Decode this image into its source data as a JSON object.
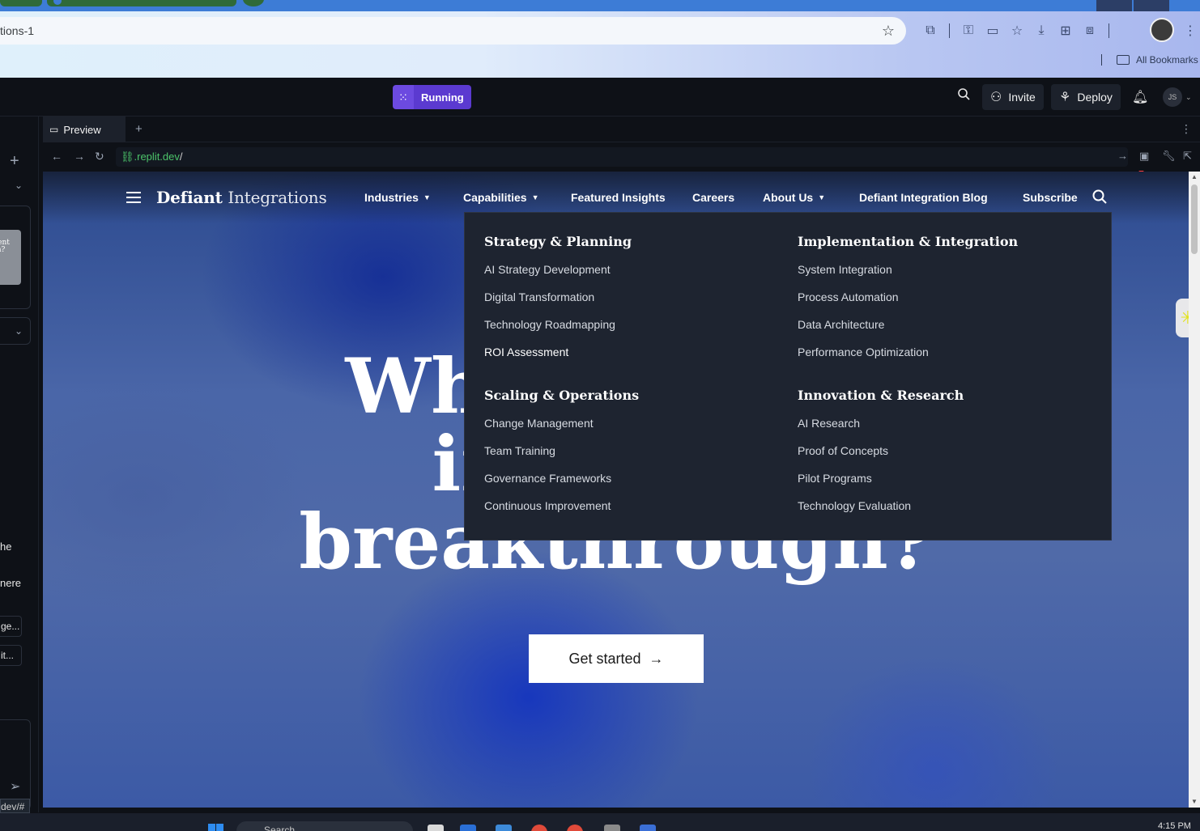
{
  "browser": {
    "address_text": "tions-1",
    "bookmarks_label": "All Bookmarks"
  },
  "replit": {
    "run_label": "Running",
    "invite_label": "Invite",
    "deploy_label": "Deploy",
    "avatar_initials": "JS",
    "left_panel_snippets": [
      "he",
      "nere",
      "ge...",
      "it..."
    ],
    "thumbnail_text": "r ent gh?",
    "status_url": "dev/#"
  },
  "preview": {
    "tab_label": "Preview",
    "url_host": ".replit.dev",
    "url_path": "/"
  },
  "site": {
    "brand_part1": "Defiant",
    "brand_part2": "Integrations",
    "nav": [
      {
        "label": "Industries",
        "has_dropdown": true
      },
      {
        "label": "Capabilities",
        "has_dropdown": true
      },
      {
        "label": "Featured Insights",
        "has_dropdown": false
      },
      {
        "label": "Careers",
        "has_dropdown": false
      },
      {
        "label": "About Us",
        "has_dropdown": true
      },
      {
        "label": "Defiant Integration Blog",
        "has_dropdown": false
      },
      {
        "label": "Subscribe",
        "has_dropdown": false
      }
    ],
    "hero_line1": "What",
    "hero_line2": "in",
    "hero_line3": "breakthrough?",
    "cta_label": "Get started",
    "dropdown": {
      "sections": [
        {
          "title": "Strategy & Planning",
          "links": [
            "AI Strategy Development",
            "Digital Transformation",
            "Technology Roadmapping",
            "ROI Assessment"
          ]
        },
        {
          "title": "Implementation & Integration",
          "links": [
            "System Integration",
            "Process Automation",
            "Data Architecture",
            "Performance Optimization"
          ]
        },
        {
          "title": "Scaling & Operations",
          "links": [
            "Change Management",
            "Team Training",
            "Governance Frameworks",
            "Continuous Improvement"
          ]
        },
        {
          "title": "Innovation & Research",
          "links": [
            "AI Research",
            "Proof of Concepts",
            "Pilot Programs",
            "Technology Evaluation"
          ]
        }
      ]
    }
  },
  "taskbar": {
    "search_placeholder": "Search",
    "clock": "4:15 PM"
  },
  "colors": {
    "run_accent": "#5b3ad0",
    "url_green": "#4cc46a",
    "dropdown_bg": "#1e2430",
    "hero_blue": "#2c4a8f"
  }
}
